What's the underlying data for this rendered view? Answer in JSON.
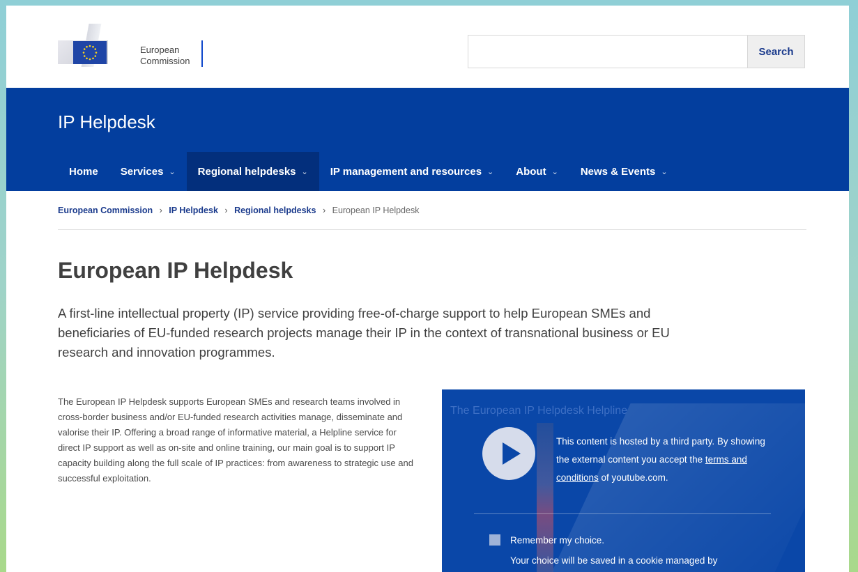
{
  "header": {
    "logo_line1": "European",
    "logo_line2": "Commission",
    "search_placeholder": "",
    "search_button": "Search"
  },
  "site": {
    "name": "IP Helpdesk"
  },
  "nav": {
    "items": [
      {
        "label": "Home",
        "has_dropdown": false
      },
      {
        "label": "Services",
        "has_dropdown": true
      },
      {
        "label": "Regional helpdesks",
        "has_dropdown": true,
        "active": true
      },
      {
        "label": "IP management and resources",
        "has_dropdown": true
      },
      {
        "label": "About",
        "has_dropdown": true
      },
      {
        "label": "News & Events",
        "has_dropdown": true
      }
    ],
    "chevron": "⌄"
  },
  "breadcrumb": {
    "items": [
      "European Commission",
      "IP Helpdesk",
      "Regional helpdesks"
    ],
    "current": "European IP Helpdesk",
    "separator": "›"
  },
  "main": {
    "title": "European IP Helpdesk",
    "lead": "A first-line intellectual property (IP) service providing free-of-charge support to help European SMEs and beneficiaries of EU-funded research projects manage their IP in the context of transnational business or EU research and innovation programmes.",
    "body": "The European IP Helpdesk supports European SMEs and research teams involved in cross-border business and/or EU-funded research activities manage, disseminate and valorise their IP. Offering a broad range of informative material, a Helpline service for direct IP support as well as on-site and online training, our main goal is to support IP capacity building along the full scale of IP practices: from awareness to strategic use and successful exploitation."
  },
  "video": {
    "title": "The European IP Helpdesk Helpline",
    "notice_before": "This content is hosted by a third party. By showing the external content you accept the ",
    "notice_link": "terms and conditions",
    "notice_after": " of youtube.com.",
    "remember_label": "Remember my choice.",
    "cookie_note": "Your choice will be saved in a cookie managed by"
  },
  "colors": {
    "brand_blue": "#033e9e",
    "nav_active": "#032f7c",
    "video_bg": "#0a47a8"
  }
}
